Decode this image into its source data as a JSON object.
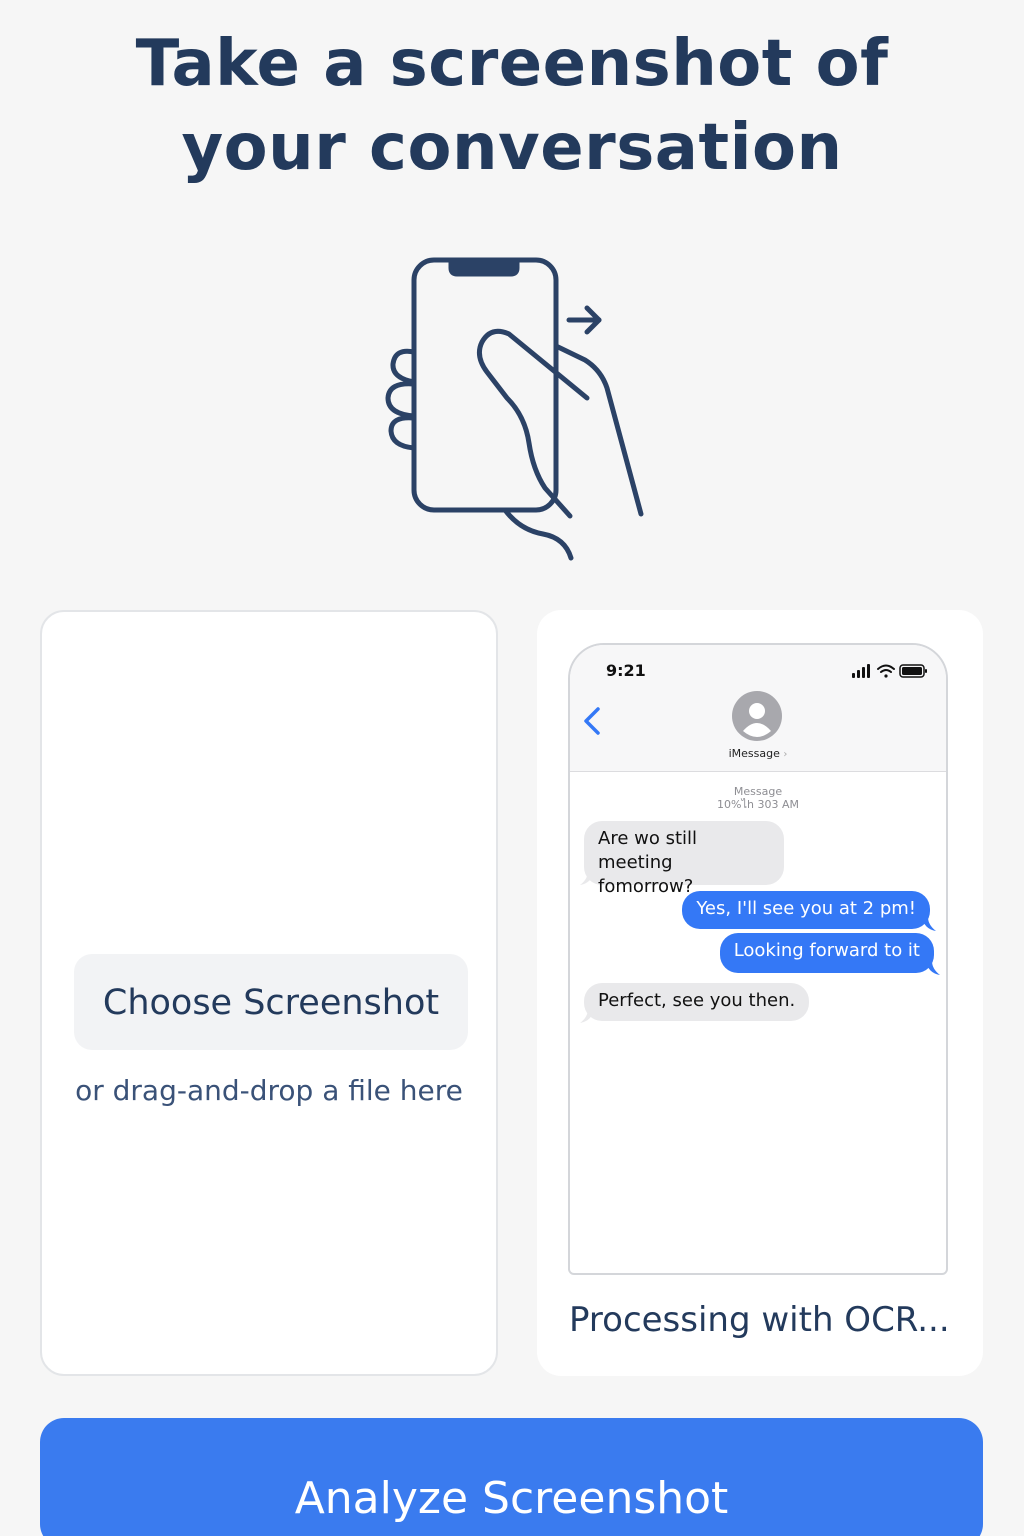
{
  "header": {
    "title_line1": "Take a screenshot of",
    "title_line2": "your conversation"
  },
  "hero": {
    "icon": "hand-holding-phone-icon",
    "stroke_color": "#2b4266"
  },
  "upload_card": {
    "choose_label": "Choose Screenshot",
    "drag_text": "or drag-and-drop a file here"
  },
  "preview_card": {
    "status_time": "9:21",
    "contact_label": "iMessage",
    "contact_chevron": "›",
    "meta_line1": "Message",
    "meta_line2": "10%ไh 303 AM",
    "messages": [
      {
        "direction": "incoming",
        "text": "Are wo still meeting fomorrow?"
      },
      {
        "direction": "outgoing",
        "text": "Yes, I'll see you at 2 pm!"
      },
      {
        "direction": "outgoing",
        "text": "Looking forward to it"
      },
      {
        "direction": "incoming",
        "text": "Perfect, see you then."
      }
    ],
    "processing_text": "Processing with OCR..."
  },
  "action": {
    "analyze_label": "Analyze Screenshot"
  },
  "colors": {
    "primary": "#3a7bef",
    "text_dark": "#233a5c",
    "bubble_out": "#3478f6",
    "bubble_in": "#e9e9eb",
    "background": "#f6f6f6"
  }
}
